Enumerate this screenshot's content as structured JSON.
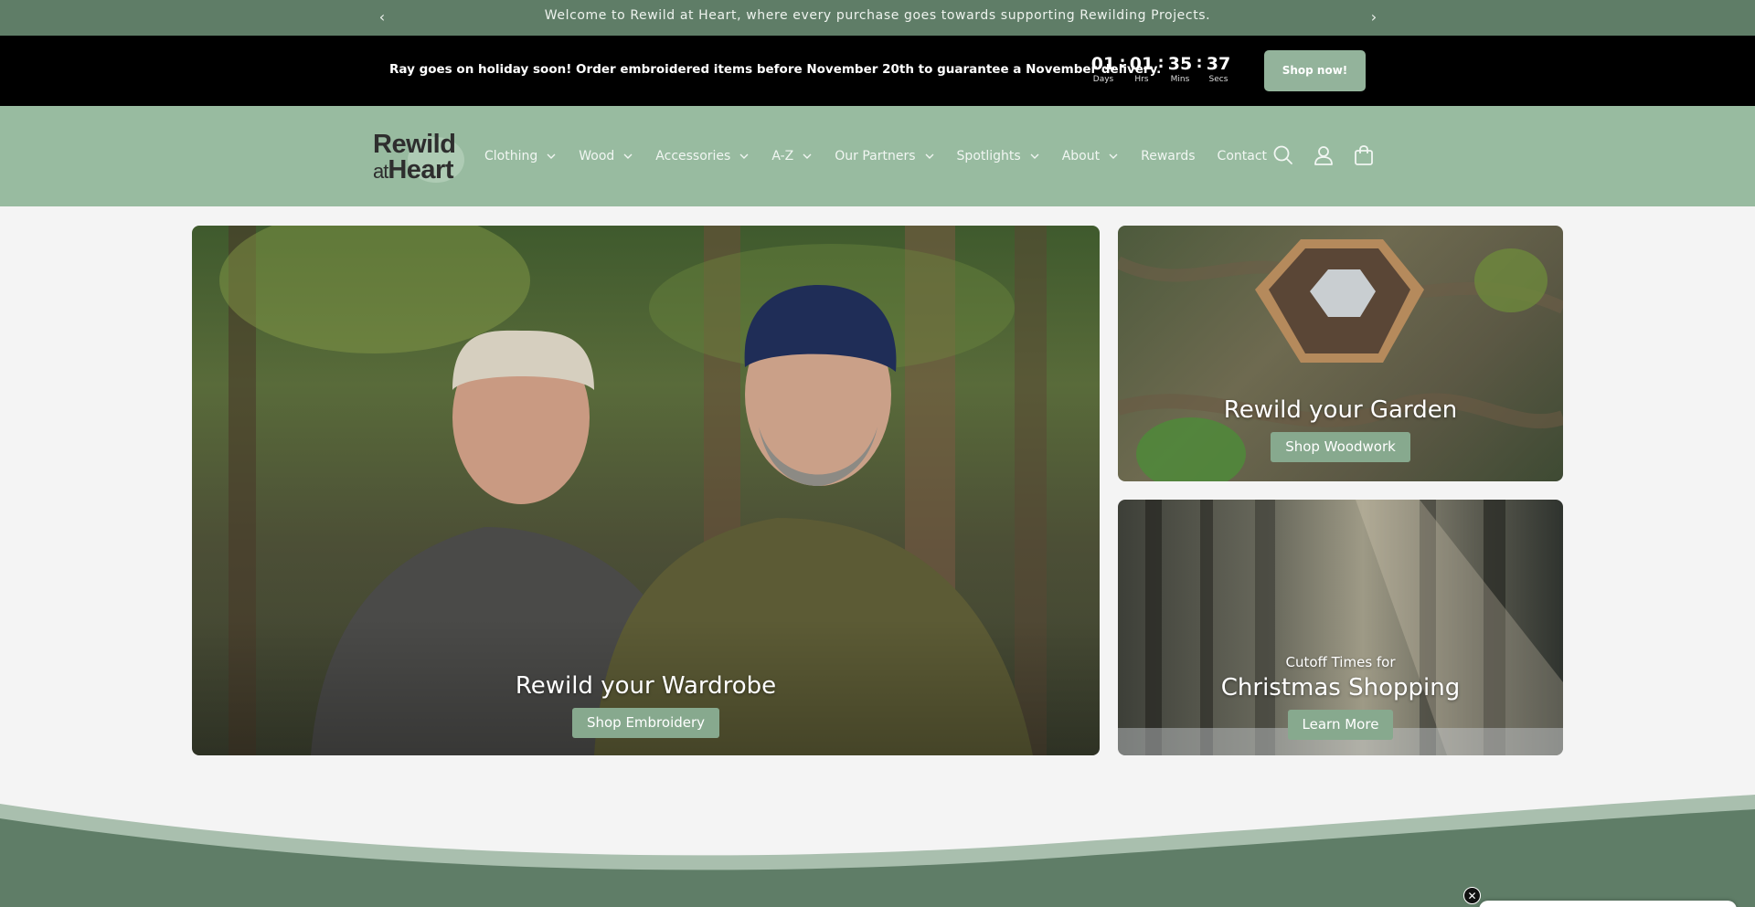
{
  "announcement": {
    "message": "Welcome to Rewild at Heart, where every purchase goes towards supporting Rewilding Projects.",
    "prev_icon": "chevron-left-icon",
    "next_icon": "chevron-right-icon",
    "prev_glyph": "‹",
    "next_glyph": "›"
  },
  "promo": {
    "text": "Ray goes on holiday soon! Order embroidered items before November 20th to guarantee a November delivery.",
    "countdown": {
      "days": "01",
      "days_label": "Days",
      "hrs": "01",
      "hrs_label": "Hrs",
      "mins": "35",
      "mins_label": "Mins",
      "secs": "37",
      "secs_label": "Secs",
      "separator": ":"
    },
    "button": "Shop now!"
  },
  "header": {
    "logo_line1": "Rewild",
    "logo_at": "at",
    "logo_line2": "Heart",
    "nav": [
      {
        "label": "Clothing",
        "dropdown": true
      },
      {
        "label": "Wood",
        "dropdown": true
      },
      {
        "label": "Accessories",
        "dropdown": true
      },
      {
        "label": "A-Z",
        "dropdown": true
      },
      {
        "label": "Our Partners",
        "dropdown": true
      },
      {
        "label": "Spotlights",
        "dropdown": true
      },
      {
        "label": "About",
        "dropdown": true
      },
      {
        "label": "Rewards",
        "dropdown": false
      },
      {
        "label": "Contact",
        "dropdown": false
      }
    ],
    "icons": [
      "search-icon",
      "account-icon",
      "cart-icon"
    ]
  },
  "hero": {
    "wardrobe": {
      "heading": "Rewild your Wardrobe",
      "button": "Shop Embroidery"
    },
    "garden": {
      "heading": "Rewild your Garden",
      "button": "Shop Woodwork"
    },
    "xmas": {
      "subheading": "Cutoff Times for",
      "heading": "Christmas Shopping",
      "button": "Learn More"
    }
  },
  "colors": {
    "announcement_bg": "#5f7d67",
    "header_bg": "#98bba0",
    "accent_button": "#87a98e",
    "footer_green": "#5f7d67"
  },
  "overlay": {
    "close_glyph": "✕"
  }
}
